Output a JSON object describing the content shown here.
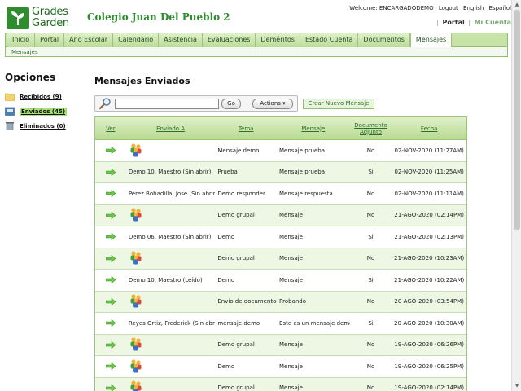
{
  "header": {
    "logo_line1": "Grades",
    "logo_line2": "Garden",
    "school_name": "Colegio Juan Del Pueblo 2",
    "welcome": "Welcome: ENCARGADODEMO",
    "logout": "Logout",
    "english": "English",
    "espanol": "Español",
    "portal": "Portal",
    "mi_cuenta": "Mi Cuenta",
    "separator": "|"
  },
  "nav": {
    "tabs": [
      "Inicio",
      "Portal",
      "Año Escolar",
      "Calendario",
      "Asistencia",
      "Evaluaciones",
      "Deméritos",
      "Estado Cuenta",
      "Documentos",
      "Mensajes"
    ],
    "active_tab": "Mensajes",
    "subnav": "Mensajes"
  },
  "sidebar": {
    "title": "Opciones",
    "items": [
      {
        "label": "Recibidos (9)",
        "icon": "folder-icon"
      },
      {
        "label": "Enviados (45)",
        "icon": "outbox-icon"
      },
      {
        "label": "Eliminados (0)",
        "icon": "trash-icon"
      }
    ]
  },
  "main": {
    "title": "Mensajes Enviados",
    "search_placeholder": "",
    "go_label": "Go",
    "actions_label": "Actions ▾",
    "new_message_label": "Crear Nuevo Mensaje"
  },
  "table": {
    "headers": {
      "ver": "Ver",
      "enviado_a": "Enviado A",
      "tema": "Tema",
      "mensaje": "Mensaje",
      "adjunto_1": "Documento",
      "adjunto_2": "Adjunto",
      "fecha": "Fecha"
    },
    "rows": [
      {
        "to": "",
        "group": true,
        "tema": "Mensaje demo",
        "mensaje": "Mensaje prueba",
        "adjunto": "No",
        "fecha": "02-NOV-2020 (11:27AM)"
      },
      {
        "to": "Demo 10, Maestro (Sin abrir)",
        "group": false,
        "tema": "Prueba",
        "mensaje": "Mensaje prueba",
        "adjunto": "Si",
        "fecha": "02-NOV-2020 (11:25AM)"
      },
      {
        "to": "Pérez Bobadilla, José (Sin abrir)",
        "group": false,
        "tema": "Demo responder",
        "mensaje": "Mensaje respuesta",
        "adjunto": "No",
        "fecha": "02-NOV-2020 (11:11AM)"
      },
      {
        "to": "",
        "group": true,
        "tema": "Demo grupal",
        "mensaje": "Mensaje",
        "adjunto": "No",
        "fecha": "21-AGO-2020 (02:14PM)"
      },
      {
        "to": "Demo 06, Maestro (Sin abrir)",
        "group": false,
        "tema": "Demo",
        "mensaje": "Mensaje",
        "adjunto": "Si",
        "fecha": "21-AGO-2020 (02:13PM)"
      },
      {
        "to": "",
        "group": true,
        "tema": "Demo grupal",
        "mensaje": "Mensaje",
        "adjunto": "No",
        "fecha": "21-AGO-2020 (10:23AM)"
      },
      {
        "to": "Demo 10, Maestro (Leído)",
        "group": false,
        "tema": "Demo",
        "mensaje": "Mensaje",
        "adjunto": "Si",
        "fecha": "21-AGO-2020 (10:22AM)"
      },
      {
        "to": "",
        "group": true,
        "tema": "Envio de documentos",
        "mensaje": "Probando",
        "adjunto": "No",
        "fecha": "20-AGO-2020 (03:54PM)"
      },
      {
        "to": "Reyes Ortiz, Frederick (Sin abrir)",
        "group": false,
        "tema": "mensaje demo",
        "mensaje": "Este es un mensaje demo",
        "adjunto": "Si",
        "fecha": "20-AGO-2020 (10:30AM)"
      },
      {
        "to": "",
        "group": true,
        "tema": "Demo grupal",
        "mensaje": "Mensaje",
        "adjunto": "No",
        "fecha": "19-AGO-2020 (06:26PM)"
      },
      {
        "to": "",
        "group": true,
        "tema": "Demo",
        "mensaje": "Mensaje",
        "adjunto": "No",
        "fecha": "19-AGO-2020 (06:25PM)"
      },
      {
        "to": "",
        "group": true,
        "tema": "Demo grupal",
        "mensaje": "Mensaje",
        "adjunto": "No",
        "fecha": "19-AGO-2020 (02:14PM)"
      }
    ]
  },
  "colors": {
    "brand": "#2f8d2f",
    "tab_bg": "#c7e3a8",
    "row_alt": "#edf7e4",
    "active_side": "#a8dc7a"
  }
}
